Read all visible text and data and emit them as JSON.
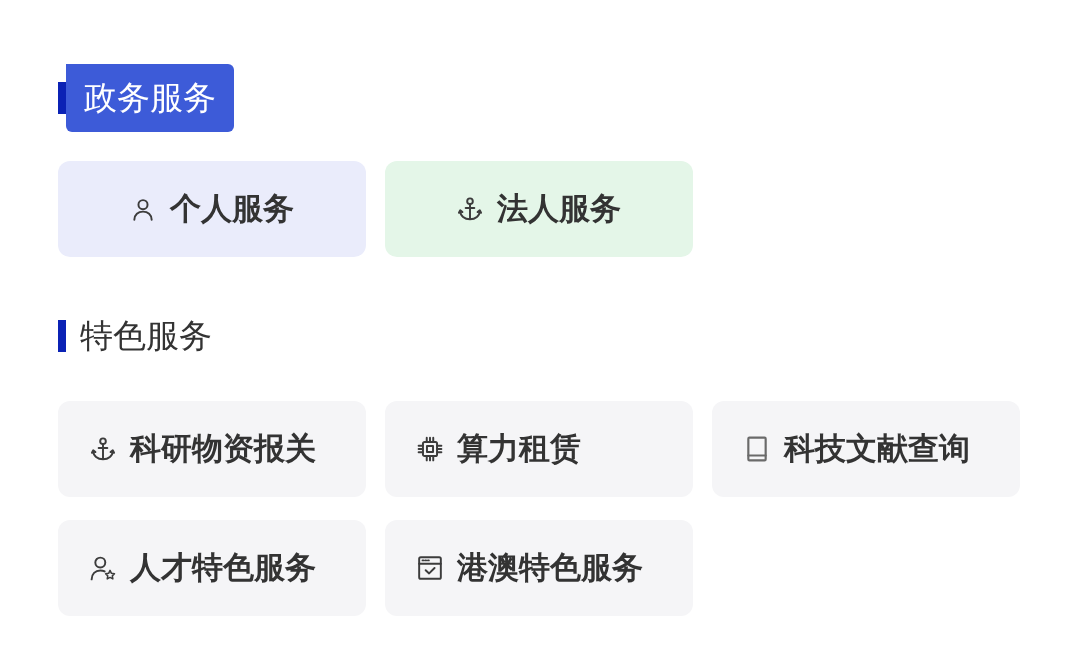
{
  "sections": [
    {
      "title": "政务服务",
      "selected": true,
      "kind": "featured",
      "items": [
        {
          "label": "个人服务",
          "color": "#eaecfb"
        },
        {
          "label": "法人服务",
          "color": "#e4f6e8"
        }
      ]
    },
    {
      "title": "特色服务",
      "selected": false,
      "kind": "grid",
      "items": [
        {
          "label": "科研物资报关"
        },
        {
          "label": "算力租赁"
        },
        {
          "label": "科技文献查询"
        },
        {
          "label": "人才特色服务"
        },
        {
          "label": "港澳特色服务"
        }
      ]
    }
  ]
}
